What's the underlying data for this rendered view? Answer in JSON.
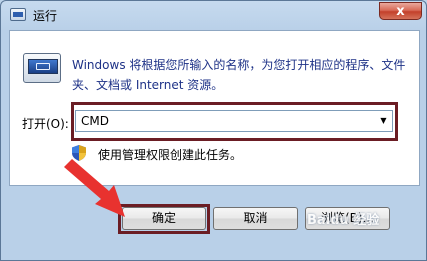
{
  "window": {
    "title": "运行",
    "close_label": "x"
  },
  "content": {
    "description": "Windows 将根据您所输入的名称，为您打开相应的程序、文件夹、文档或 Internet 资源。",
    "open_label": "打开(O):",
    "command_value": "CMD",
    "admin_note": "使用管理权限创建此任务。"
  },
  "buttons": {
    "ok": "确定",
    "cancel": "取消",
    "browse": "浏览(B)..."
  },
  "watermark": "Baidu 经验",
  "colors": {
    "highlight_border": "#6b1d24",
    "arrow": "#e8322f",
    "description_text": "#1e3287"
  },
  "icons": {
    "title": "run-icon",
    "main": "run-icon",
    "admin": "uac-shield-icon"
  }
}
